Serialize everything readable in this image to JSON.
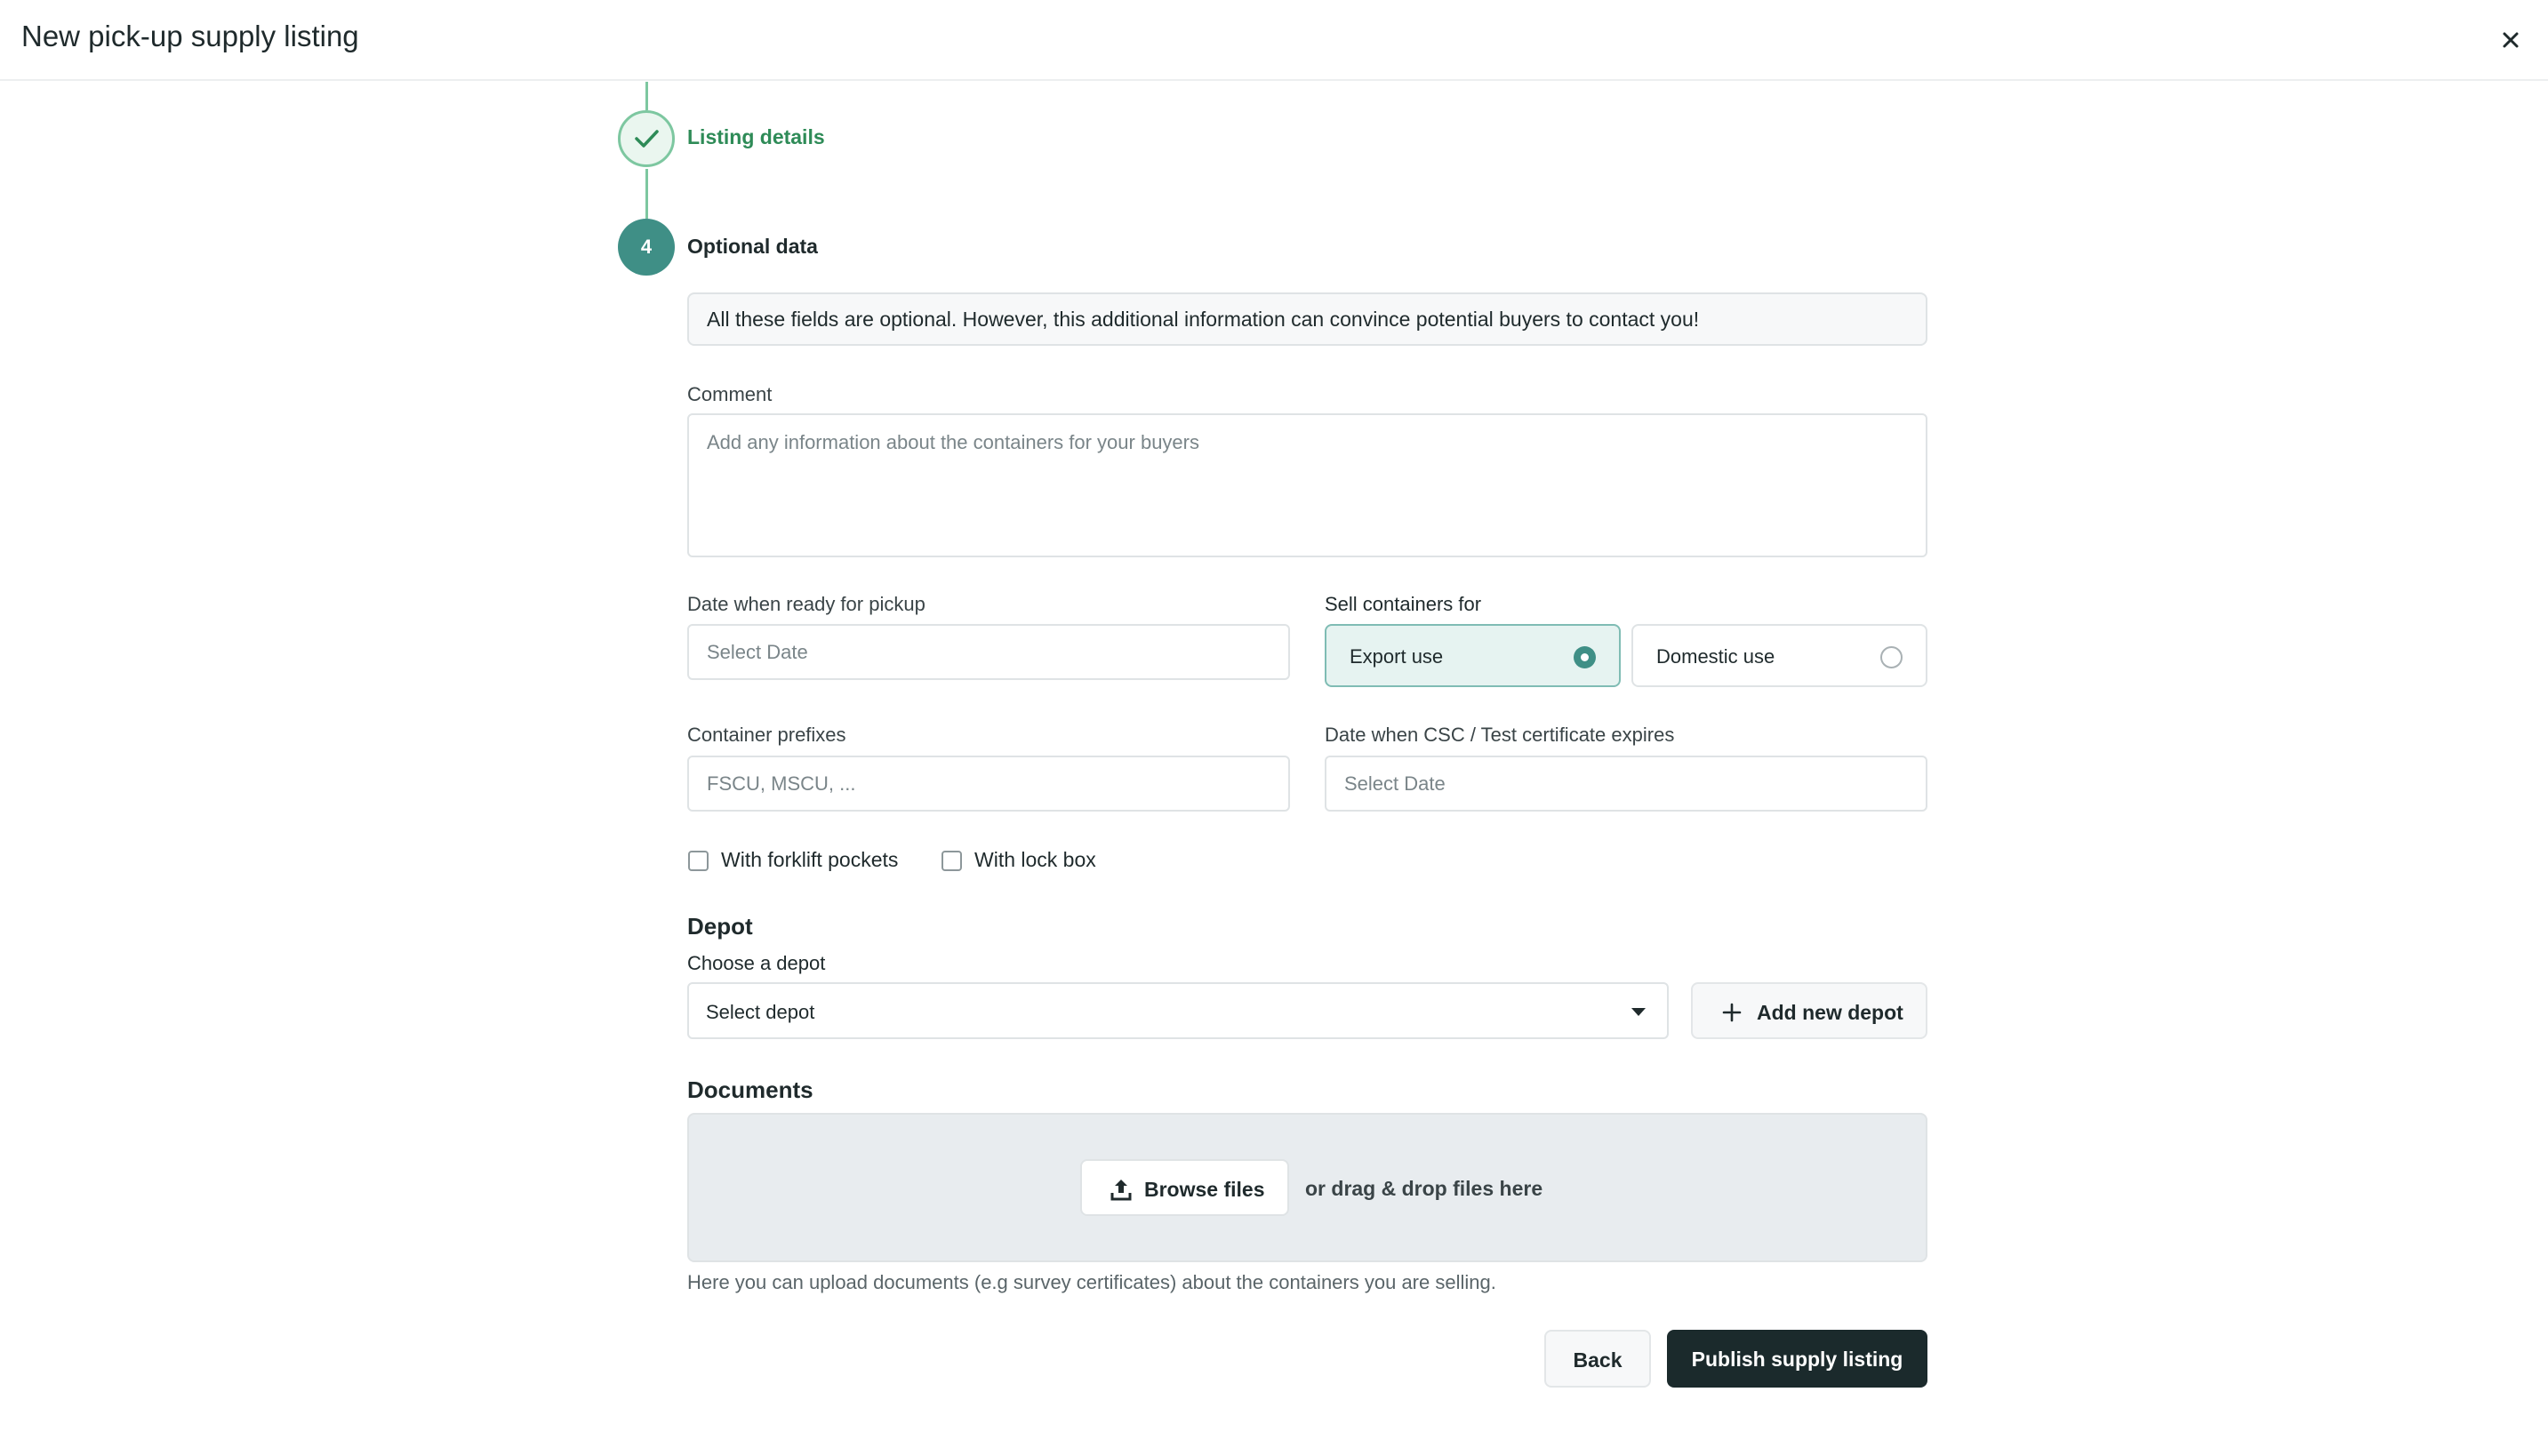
{
  "header": {
    "title": "New pick-up supply listing",
    "close_icon": "close-icon"
  },
  "stepper": {
    "completed_step": {
      "label": "Listing details",
      "icon": "check-icon"
    },
    "current_step": {
      "number": "4",
      "label": "Optional data"
    }
  },
  "form": {
    "info_text": "All these fields are optional. However, this additional information can convince potential buyers to contact you!",
    "comment": {
      "label": "Comment",
      "placeholder": "Add any information about the containers for your buyers",
      "value": ""
    },
    "ready_date": {
      "label": "Date when ready for pickup",
      "placeholder": "Select Date",
      "value": ""
    },
    "sell_for": {
      "label": "Sell containers for",
      "options": [
        {
          "label": "Export use",
          "selected": true
        },
        {
          "label": "Domestic use",
          "selected": false
        }
      ]
    },
    "prefixes": {
      "label": "Container prefixes",
      "placeholder": "FSCU, MSCU, ...",
      "value": ""
    },
    "csc_date": {
      "label": "Date when CSC / Test certificate expires",
      "placeholder": "Select Date",
      "value": ""
    },
    "checkboxes": [
      {
        "label": "With forklift pockets",
        "checked": false
      },
      {
        "label": "With lock box",
        "checked": false
      }
    ]
  },
  "depot": {
    "title": "Depot",
    "label": "Choose a depot",
    "selected": "Select depot",
    "add_button": "Add new depot"
  },
  "documents": {
    "title": "Documents",
    "browse_button": "Browse files",
    "drop_text": "or drag & drop files here",
    "help_text": "Here you can upload documents (e.g survey certificates) about the containers you are selling."
  },
  "actions": {
    "back": "Back",
    "publish": "Publish supply listing"
  },
  "colors": {
    "accent": "#3f8f86",
    "success": "#2e8b57",
    "primary_button": "#1b2a2c"
  }
}
